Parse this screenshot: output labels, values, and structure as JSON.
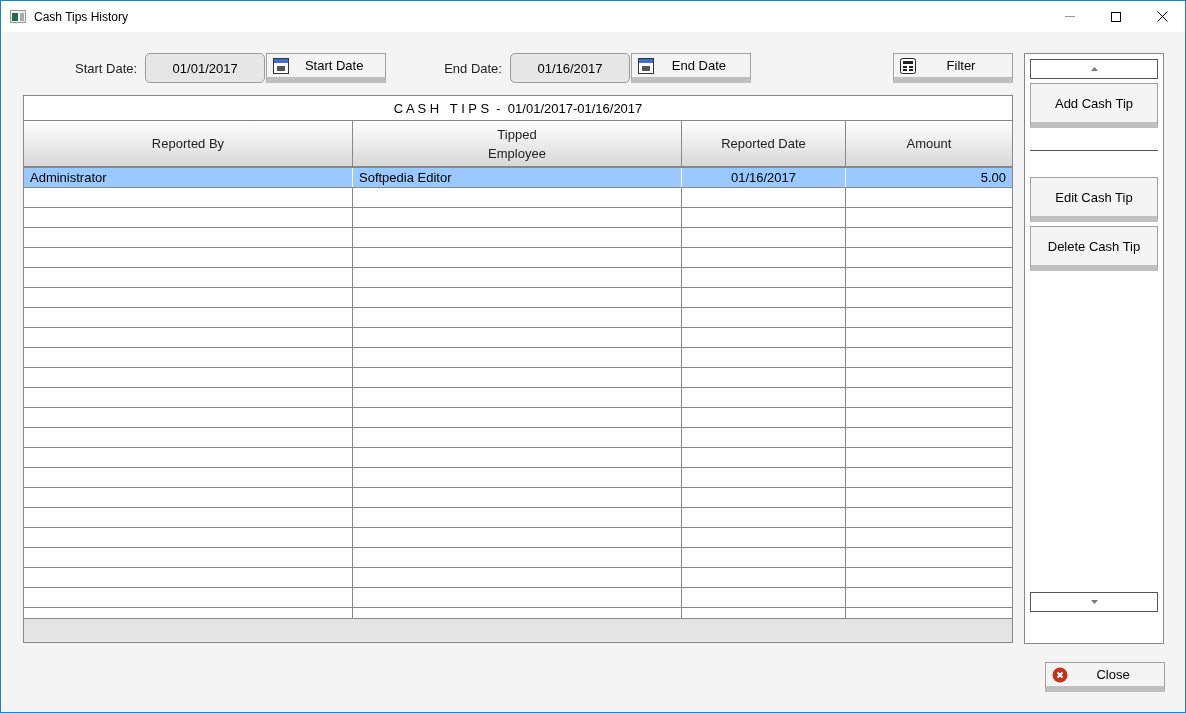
{
  "window": {
    "title": "Cash Tips History"
  },
  "date_range": {
    "start_label": "Start Date:",
    "start_value": "01/01/2017",
    "start_button": "Start Date",
    "end_label": "End Date:",
    "end_value": "01/16/2017",
    "end_button": "End Date",
    "filter_button": "Filter"
  },
  "table": {
    "title": "C A S H   T I P S  -  01/01/2017-01/16/2017",
    "columns": [
      {
        "label": "Reported By"
      },
      {
        "label": "Tipped\nEmployee"
      },
      {
        "label": "Reported Date"
      },
      {
        "label": "Amount"
      }
    ],
    "rows": [
      {
        "selected": true,
        "cells": [
          "Administrator",
          "Softpedia Editor",
          "01/16/2017",
          "5.00"
        ]
      }
    ]
  },
  "side_panel": {
    "buttons": [
      "Add Cash Tip",
      "Edit Cash Tip",
      "Delete Cash Tip"
    ]
  },
  "close_button": "Close"
}
